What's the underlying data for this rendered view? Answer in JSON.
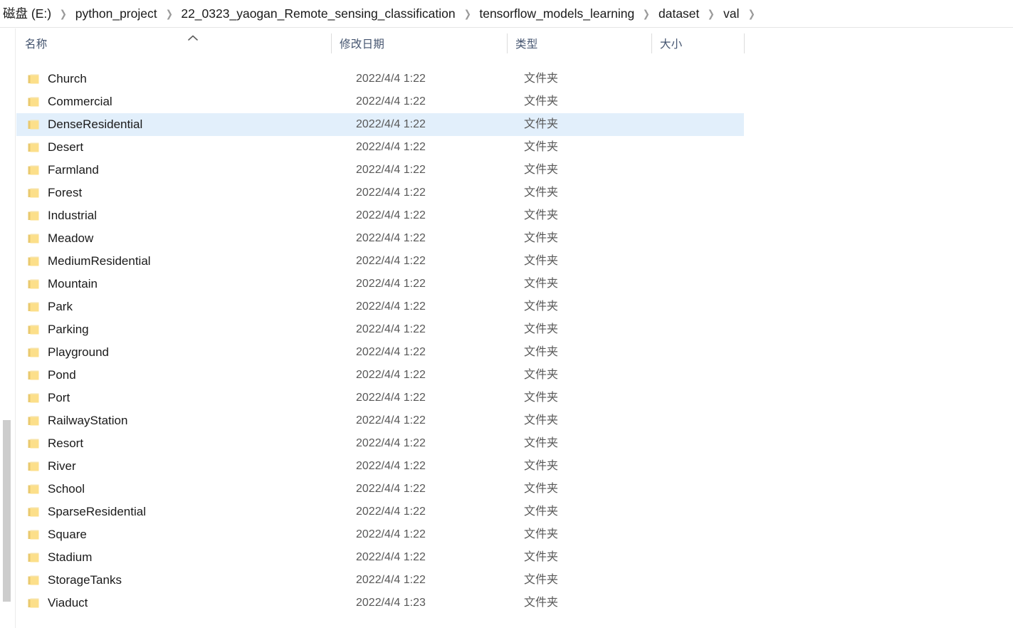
{
  "breadcrumb": {
    "items": [
      {
        "label": "磁盘 (E:)",
        "name": "breadcrumb-item-disk-e"
      },
      {
        "label": "python_project",
        "name": "breadcrumb-item-python-project"
      },
      {
        "label": "22_0323_yaogan_Remote_sensing_classification",
        "name": "breadcrumb-item-yaogan"
      },
      {
        "label": "tensorflow_models_learning",
        "name": "breadcrumb-item-tensorflow-models-learning"
      },
      {
        "label": "dataset",
        "name": "breadcrumb-item-dataset"
      },
      {
        "label": "val",
        "name": "breadcrumb-item-val"
      }
    ],
    "separator": "❯"
  },
  "columns": {
    "name": {
      "label": "名称",
      "sort": "ascending",
      "sort_icon": "caret-up-icon"
    },
    "date_modified": {
      "label": "修改日期"
    },
    "type": {
      "label": "类型"
    },
    "size": {
      "label": "大小"
    }
  },
  "colors": {
    "selection": "#e2effb",
    "folder_icon": "#fcdf8a",
    "header_text": "#44546f",
    "row_secondary_text": "#585858",
    "scrollbar_thumb": "#cdcdcd"
  },
  "scrollbar": {
    "orientation": "vertical",
    "position": "left"
  },
  "rows": [
    {
      "name": "Church",
      "date": "2022/4/4 1:22",
      "type": "文件夹",
      "size": "",
      "selected": false
    },
    {
      "name": "Commercial",
      "date": "2022/4/4 1:22",
      "type": "文件夹",
      "size": "",
      "selected": false
    },
    {
      "name": "DenseResidential",
      "date": "2022/4/4 1:22",
      "type": "文件夹",
      "size": "",
      "selected": true
    },
    {
      "name": "Desert",
      "date": "2022/4/4 1:22",
      "type": "文件夹",
      "size": "",
      "selected": false
    },
    {
      "name": "Farmland",
      "date": "2022/4/4 1:22",
      "type": "文件夹",
      "size": "",
      "selected": false
    },
    {
      "name": "Forest",
      "date": "2022/4/4 1:22",
      "type": "文件夹",
      "size": "",
      "selected": false
    },
    {
      "name": "Industrial",
      "date": "2022/4/4 1:22",
      "type": "文件夹",
      "size": "",
      "selected": false
    },
    {
      "name": "Meadow",
      "date": "2022/4/4 1:22",
      "type": "文件夹",
      "size": "",
      "selected": false
    },
    {
      "name": "MediumResidential",
      "date": "2022/4/4 1:22",
      "type": "文件夹",
      "size": "",
      "selected": false
    },
    {
      "name": "Mountain",
      "date": "2022/4/4 1:22",
      "type": "文件夹",
      "size": "",
      "selected": false
    },
    {
      "name": "Park",
      "date": "2022/4/4 1:22",
      "type": "文件夹",
      "size": "",
      "selected": false
    },
    {
      "name": "Parking",
      "date": "2022/4/4 1:22",
      "type": "文件夹",
      "size": "",
      "selected": false
    },
    {
      "name": "Playground",
      "date": "2022/4/4 1:22",
      "type": "文件夹",
      "size": "",
      "selected": false
    },
    {
      "name": "Pond",
      "date": "2022/4/4 1:22",
      "type": "文件夹",
      "size": "",
      "selected": false
    },
    {
      "name": "Port",
      "date": "2022/4/4 1:22",
      "type": "文件夹",
      "size": "",
      "selected": false
    },
    {
      "name": "RailwayStation",
      "date": "2022/4/4 1:22",
      "type": "文件夹",
      "size": "",
      "selected": false
    },
    {
      "name": "Resort",
      "date": "2022/4/4 1:22",
      "type": "文件夹",
      "size": "",
      "selected": false
    },
    {
      "name": "River",
      "date": "2022/4/4 1:22",
      "type": "文件夹",
      "size": "",
      "selected": false
    },
    {
      "name": "School",
      "date": "2022/4/4 1:22",
      "type": "文件夹",
      "size": "",
      "selected": false
    },
    {
      "name": "SparseResidential",
      "date": "2022/4/4 1:22",
      "type": "文件夹",
      "size": "",
      "selected": false
    },
    {
      "name": "Square",
      "date": "2022/4/4 1:22",
      "type": "文件夹",
      "size": "",
      "selected": false
    },
    {
      "name": "Stadium",
      "date": "2022/4/4 1:22",
      "type": "文件夹",
      "size": "",
      "selected": false
    },
    {
      "name": "StorageTanks",
      "date": "2022/4/4 1:22",
      "type": "文件夹",
      "size": "",
      "selected": false
    },
    {
      "name": "Viaduct",
      "date": "2022/4/4 1:23",
      "type": "文件夹",
      "size": "",
      "selected": false
    }
  ]
}
